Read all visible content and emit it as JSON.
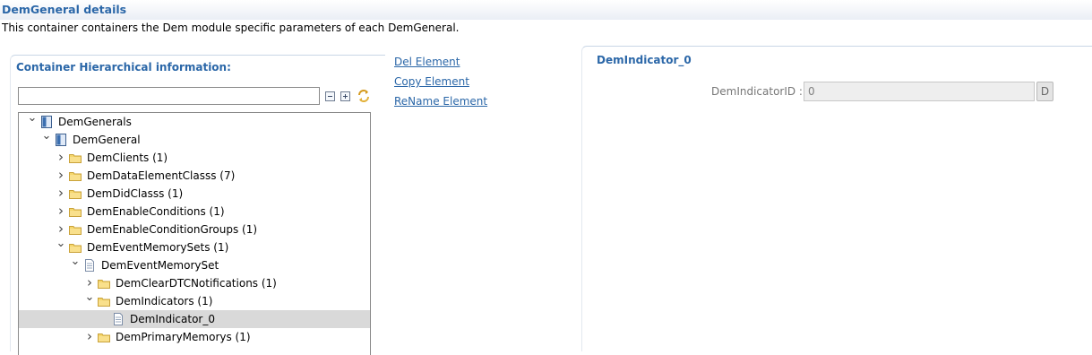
{
  "header": {
    "title": "DemGeneral details",
    "description": "This container containers the Dem module specific parameters of each DemGeneral."
  },
  "left_panel": {
    "title": "Container Hierarchical information:",
    "filter": {
      "value": "",
      "placeholder": ""
    },
    "toolbar": [
      "collapse-all-icon",
      "expand-all-icon",
      "sync-icon"
    ],
    "tree": [
      {
        "label": "DemGenerals",
        "level": 0,
        "expanded": true,
        "icon": "module-icon"
      },
      {
        "label": "DemGeneral",
        "level": 1,
        "expanded": true,
        "icon": "module-icon"
      },
      {
        "label": "DemClients (1)",
        "level": 2,
        "expanded": false,
        "icon": "folder-icon"
      },
      {
        "label": "DemDataElementClasss (7)",
        "level": 2,
        "expanded": false,
        "icon": "folder-icon"
      },
      {
        "label": "DemDidClasss (1)",
        "level": 2,
        "expanded": false,
        "icon": "folder-icon"
      },
      {
        "label": "DemEnableConditions (1)",
        "level": 2,
        "expanded": false,
        "icon": "folder-icon"
      },
      {
        "label": "DemEnableConditionGroups (1)",
        "level": 2,
        "expanded": false,
        "icon": "folder-icon"
      },
      {
        "label": "DemEventMemorySets (1)",
        "level": 2,
        "expanded": true,
        "icon": "folder-icon"
      },
      {
        "label": "DemEventMemorySet",
        "level": 3,
        "expanded": true,
        "icon": "document-icon"
      },
      {
        "label": "DemClearDTCNotifications (1)",
        "level": 4,
        "expanded": false,
        "icon": "folder-icon"
      },
      {
        "label": "DemIndicators (1)",
        "level": 4,
        "expanded": true,
        "icon": "folder-icon"
      },
      {
        "label": "DemIndicator_0",
        "level": 5,
        "expanded": null,
        "icon": "document-icon",
        "selected": true
      },
      {
        "label": "DemPrimaryMemorys (1)",
        "level": 4,
        "expanded": false,
        "icon": "folder-icon"
      }
    ]
  },
  "actions": {
    "delete": "Del Element",
    "copy": "Copy Element",
    "rename": "ReName Element"
  },
  "right_panel": {
    "title": "DemIndicator_0",
    "field": {
      "label": "DemIndicatorID :",
      "value": "0",
      "button": "D"
    }
  },
  "colors": {
    "accent": "#2b67a8",
    "selection": "#d9d9d9",
    "folder": "#f2cf63"
  }
}
